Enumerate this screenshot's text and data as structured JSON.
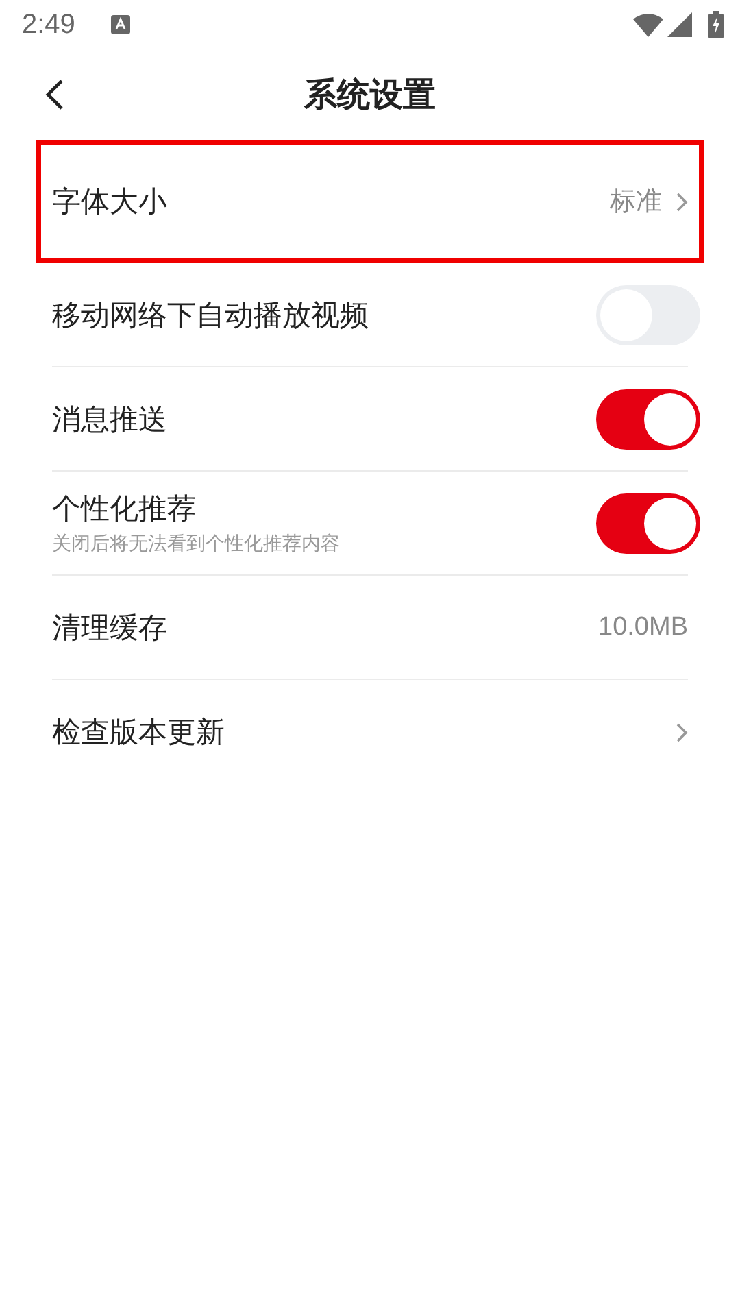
{
  "status_bar": {
    "time": "2:49"
  },
  "nav": {
    "title": "系统设置"
  },
  "rows": [
    {
      "kind": "link",
      "label": "字体大小",
      "value": "标准",
      "highlighted": true
    },
    {
      "kind": "toggle",
      "label": "移动网络下自动播放视频",
      "on": false,
      "highlighted": false
    },
    {
      "kind": "toggle",
      "label": "消息推送",
      "on": true,
      "highlighted": false
    },
    {
      "kind": "toggle",
      "label": "个性化推荐",
      "subtitle": "关闭后将无法看到个性化推荐内容",
      "on": true,
      "highlighted": false
    },
    {
      "kind": "value",
      "label": "清理缓存",
      "value": "10.0MB",
      "highlighted": false
    },
    {
      "kind": "link",
      "label": "检查版本更新",
      "highlighted": false
    }
  ]
}
